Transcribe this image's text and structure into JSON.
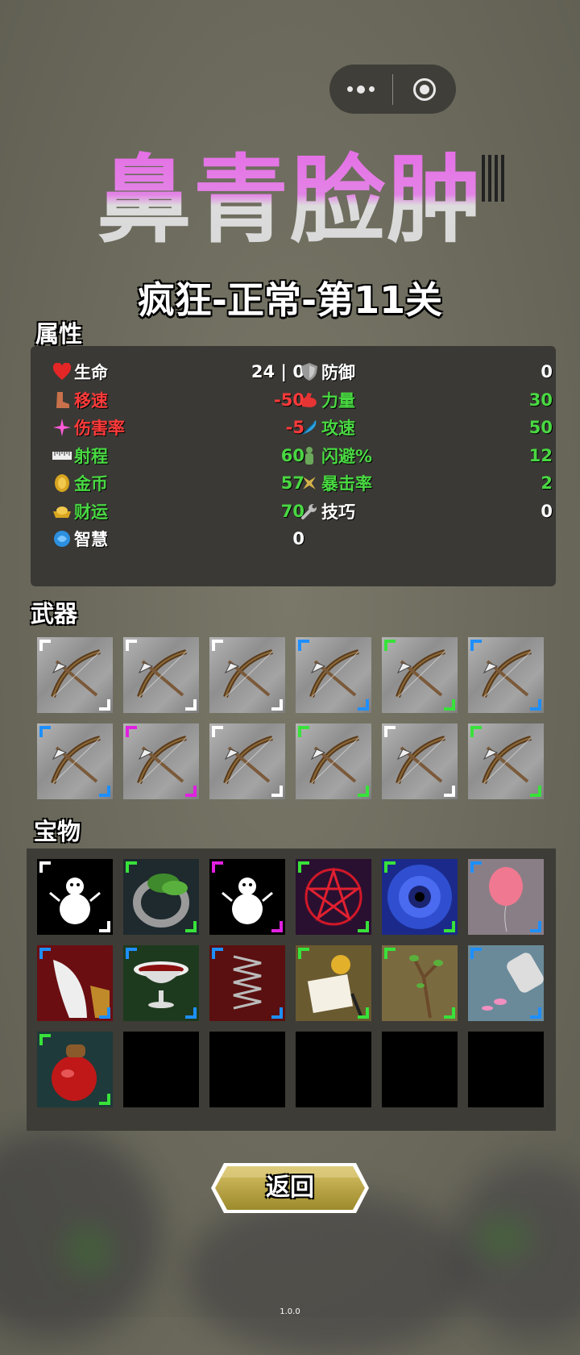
{
  "title": "鼻青脸肿",
  "subtitle": "疯狂-正常-第11关",
  "sections": {
    "attributes": "属性",
    "weapons": "武器",
    "treasures": "宝物"
  },
  "stats_left": [
    {
      "name": "生命",
      "value": "24 | 0",
      "icon": "heart-icon",
      "tone": "white"
    },
    {
      "name": "移速",
      "value": "-50",
      "icon": "boot-icon",
      "tone": "red"
    },
    {
      "name": "伤害率",
      "value": "-5",
      "icon": "sparkle-icon",
      "tone": "red"
    },
    {
      "name": "射程",
      "value": "60",
      "icon": "ruler-icon",
      "tone": "green"
    },
    {
      "name": "金币",
      "value": "57",
      "icon": "coin-icon",
      "tone": "green"
    },
    {
      "name": "财运",
      "value": "70",
      "icon": "gold-ingot-icon",
      "tone": "green"
    },
    {
      "name": "智慧",
      "value": "0",
      "icon": "brain-icon",
      "tone": "white"
    }
  ],
  "stats_right": [
    {
      "name": "防御",
      "value": "0",
      "icon": "shield-icon",
      "tone": "white"
    },
    {
      "name": "力量",
      "value": "30",
      "icon": "bicep-icon",
      "tone": "green"
    },
    {
      "name": "攻速",
      "value": "50",
      "icon": "feather-icon",
      "tone": "green"
    },
    {
      "name": "闪避%",
      "value": "12",
      "icon": "dodge-figure-icon",
      "tone": "green"
    },
    {
      "name": "暴击率",
      "value": "2",
      "icon": "shuriken-icon",
      "tone": "green"
    },
    {
      "name": "技巧",
      "value": "0",
      "icon": "wrench-icon",
      "tone": "white"
    }
  ],
  "weapon_rarity_colors": [
    "#ffffff",
    "#ffffff",
    "#ffffff",
    "#1e8fff",
    "#38e23a",
    "#1e8fff",
    "#1e8fff",
    "#e020e0",
    "#ffffff",
    "#38e23a",
    "#ffffff",
    "#38e23a"
  ],
  "weapon_icon": "crossbow-icon",
  "treasures": [
    {
      "icon": "snowman-icon",
      "rarity": "#ffffff"
    },
    {
      "icon": "leaf-ring-icon",
      "rarity": "#38e23a"
    },
    {
      "icon": "snowman-icon",
      "rarity": "#e020e0"
    },
    {
      "icon": "pentagram-icon",
      "rarity": "#38e23a"
    },
    {
      "icon": "vortex-icon",
      "rarity": "#38e23a"
    },
    {
      "icon": "balloon-icon",
      "rarity": "#1e8fff"
    },
    {
      "icon": "fang-icon",
      "rarity": "#1e8fff"
    },
    {
      "icon": "bloody-bowl-icon",
      "rarity": "#1e8fff"
    },
    {
      "icon": "spring-icon",
      "rarity": "#1e8fff"
    },
    {
      "icon": "contract-icon",
      "rarity": "#38e23a"
    },
    {
      "icon": "sapling-icon",
      "rarity": "#38e23a"
    },
    {
      "icon": "spilled-jar-icon",
      "rarity": "#1e8fff"
    },
    {
      "icon": "potion-icon",
      "rarity": "#38e23a"
    }
  ],
  "back_button": "返回",
  "version": "1.0.0",
  "colors": {
    "title_pink": "#e56de6",
    "stat_red": "#ff3a3a",
    "stat_green": "#49d842",
    "panel": "#3a3935"
  }
}
